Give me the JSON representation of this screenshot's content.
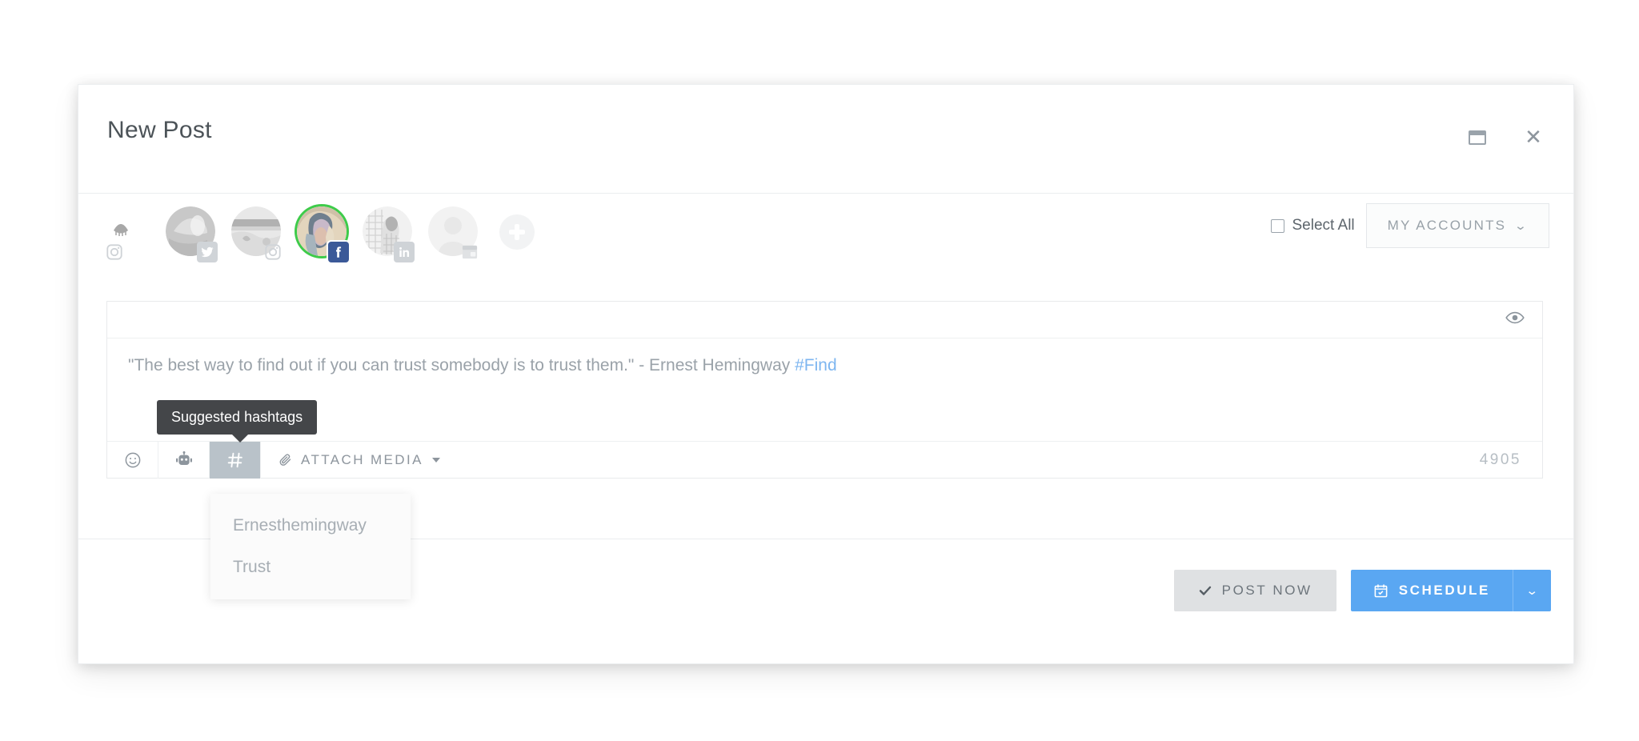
{
  "window": {
    "title": "New Post",
    "maximize_icon": "maximize-icon",
    "close_icon": "close-icon",
    "close_glyph": "✕"
  },
  "accounts": {
    "avatars": [
      {
        "id": "account-1",
        "network": "instagram",
        "badge_glyph": "",
        "selected": false,
        "tiny": true
      },
      {
        "id": "account-2",
        "network": "twitter",
        "badge_glyph": "",
        "selected": false,
        "tiny": false
      },
      {
        "id": "account-3",
        "network": "instagram",
        "badge_glyph": "",
        "selected": false,
        "tiny": false
      },
      {
        "id": "account-4",
        "network": "facebook",
        "badge_glyph": "f",
        "selected": true,
        "tiny": false
      },
      {
        "id": "account-5",
        "network": "linkedin",
        "badge_glyph": "in",
        "selected": false,
        "tiny": false
      },
      {
        "id": "account-6",
        "network": "generic",
        "badge_glyph": "",
        "selected": false,
        "tiny": false
      }
    ],
    "add_account_label": "+",
    "select_all_label": "Select All",
    "select_all_checked": false,
    "my_accounts_label": "MY ACCOUNTS",
    "my_accounts_caret": "⌄"
  },
  "editor": {
    "preview_icon": "eye-icon",
    "text_before_hashtag": "\"The best way to find out if you can trust somebody is to trust them.\" - Ernest Hemingway ",
    "hashtag": "#Find",
    "character_count": "4905",
    "toolbar": {
      "emoji_icon": "emoji-icon",
      "bot_icon": "bot-icon",
      "hashtag_icon": "hashtag-icon",
      "hashtag_active": true,
      "attach_media_label": "ATTACH MEDIA",
      "attach_media_icon": "paperclip-icon",
      "attach_media_caret": "▾"
    }
  },
  "tooltip": {
    "text": "Suggested hashtags"
  },
  "hashtag_suggestions": {
    "items": [
      {
        "label": "Ernesthemingway"
      },
      {
        "label": "Trust"
      }
    ]
  },
  "footer": {
    "post_now_label": "POST NOW",
    "post_now_icon": "check-icon",
    "schedule_label": "SCHEDULE",
    "schedule_icon": "calendar-icon",
    "schedule_caret": "⌄"
  },
  "colors": {
    "accent_blue": "#5aa7f2",
    "hashtag_blue": "#7eb6f0",
    "selected_ring_green": "#3ecb4a",
    "tooltip_bg": "#444649",
    "post_now_bg": "#dfe1e3",
    "toolbar_active_bg": "#b9c2c9",
    "facebook_blue": "#3b5998"
  }
}
